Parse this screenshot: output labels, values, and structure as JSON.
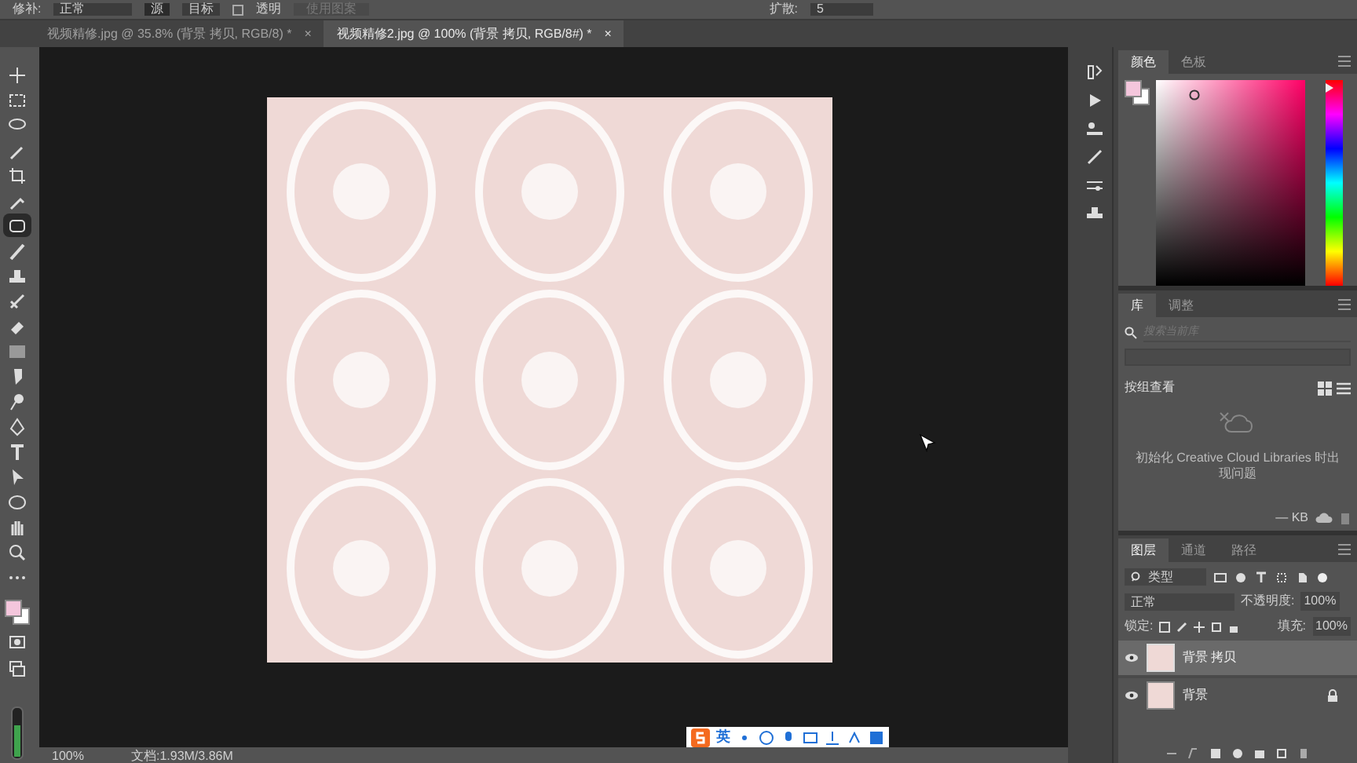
{
  "options_bar": {
    "patch_label": "修补:",
    "patch_mode": "正常",
    "source": {
      "label": "源",
      "selected": true
    },
    "destination": {
      "label": "目标",
      "selected": false
    },
    "transparent": {
      "label": "透明",
      "checked": false
    },
    "use_pattern": "使用图案",
    "diffusion_label": "扩散:",
    "diffusion_value": "5"
  },
  "document_tabs": [
    {
      "title": "视频精修.jpg @ 35.8% (背景 拷贝, RGB/8) *",
      "close": "×",
      "selected": false
    },
    {
      "title": "视频精修2.jpg @ 100% (背景 拷贝, RGB/8#) *",
      "close": "×",
      "selected": true
    }
  ],
  "tools": [
    {
      "selected": false
    },
    {
      "selected": false
    },
    {
      "selected": false
    },
    {
      "selected": false
    },
    {
      "selected": false
    },
    {
      "selected": false
    },
    {
      "selected": true
    },
    {
      "selected": false
    },
    {
      "selected": false
    },
    {
      "selected": false
    },
    {
      "selected": false
    },
    {
      "selected": false
    },
    {
      "selected": false
    },
    {
      "selected": false
    },
    {
      "selected": false
    },
    {
      "selected": false
    },
    {
      "selected": false
    },
    {
      "selected": false
    },
    {
      "selected": false
    },
    {
      "selected": false
    },
    {
      "selected": false
    }
  ],
  "status_bar": {
    "zoom": "100%",
    "doc_size": "文档:1.93M/3.86M"
  },
  "ime_toolbar": {
    "mode": "英"
  },
  "color_panel": {
    "tabs": [
      {
        "label": "颜色",
        "selected": true
      },
      {
        "label": "色板",
        "selected": false
      }
    ],
    "hue_slider": {
      "level": 0.96
    }
  },
  "libraries_panel": {
    "tabs": [
      {
        "label": "库",
        "selected": true
      },
      {
        "label": "调整",
        "selected": false
      }
    ],
    "search_placeholder": "搜索当前库",
    "view_label": "按组查看",
    "message": "初始化 Creative Cloud Libraries 时出现问题",
    "size": "— KB"
  },
  "layers_panel": {
    "tabs": [
      {
        "label": "图层",
        "selected": true
      },
      {
        "label": "通道",
        "selected": false
      },
      {
        "label": "路径",
        "selected": false
      }
    ],
    "filter": "类型",
    "blend_mode": "正常",
    "opacity_label": "不透明度:",
    "opacity": "100%",
    "lock_label": "锁定:",
    "fill_label": "填充:",
    "fill": "100%",
    "layers": [
      {
        "name": "背景 拷贝",
        "visible": true,
        "selected": true,
        "locked": false
      },
      {
        "name": "背景",
        "visible": true,
        "selected": false,
        "locked": true
      }
    ]
  }
}
